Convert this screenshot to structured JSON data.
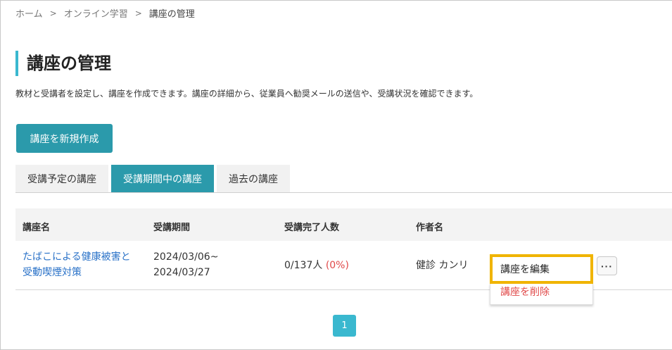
{
  "breadcrumb": {
    "home": "ホーム",
    "learning": "オンライン学習",
    "current": "講座の管理",
    "separator": ">"
  },
  "page": {
    "title": "講座の管理",
    "description": "教材と受講者を設定し、講座を作成できます。講座の詳細から、従業員へ勧奨メールの送信や、受講状況を確認できます。"
  },
  "toolbar": {
    "new_course_label": "講座を新規作成"
  },
  "tabs": [
    {
      "label": "受講予定の講座",
      "active": false
    },
    {
      "label": "受講期間中の講座",
      "active": true
    },
    {
      "label": "過去の講座",
      "active": false
    }
  ],
  "table": {
    "headers": {
      "name": "講座名",
      "period": "受講期間",
      "completed": "受講完了人数",
      "author": "作者名"
    },
    "rows": [
      {
        "name_line1": "たばこによる健康被害と",
        "name_line2": "受動喫煙対策",
        "period_start": "2024/03/06~",
        "period_end": "2024/03/27",
        "completed": "0/137人",
        "completed_pct": "(0%)",
        "author": "健診 カンリ"
      }
    ]
  },
  "menu": {
    "edit_label": "講座を編集",
    "delete_label": "講座を削除",
    "more_label": "···"
  },
  "pagination": {
    "current_page": "1"
  },
  "colors": {
    "accent": "#2b9aab",
    "title_bar": "#3ab8cf",
    "link": "#2a72c8",
    "danger": "#e04848",
    "highlight": "#f0b400"
  }
}
